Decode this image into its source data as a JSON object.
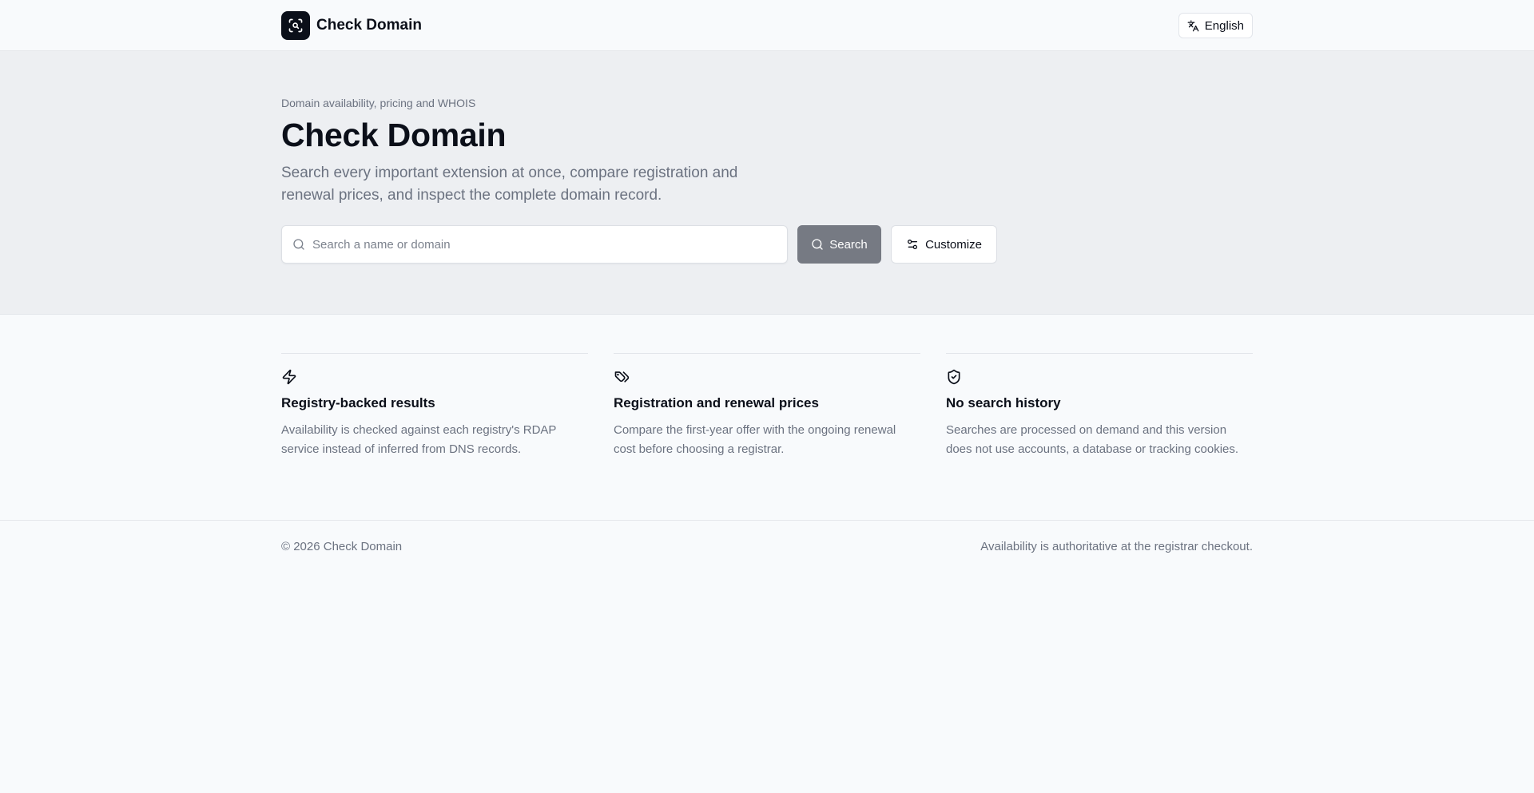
{
  "header": {
    "brand_name": "Check Domain",
    "language_label": "English"
  },
  "hero": {
    "eyebrow": "Domain availability, pricing and WHOIS",
    "title": "Check Domain",
    "description": "Search every important extension at once, compare registration and renewal prices, and inspect the complete domain record.",
    "search": {
      "placeholder": "Search a name or domain",
      "value": "",
      "button_label": "Search"
    },
    "customize_label": "Customize"
  },
  "features": [
    {
      "icon": "zap-icon",
      "title": "Registry-backed results",
      "description": "Availability is checked against each registry's RDAP service instead of inferred from DNS records."
    },
    {
      "icon": "tags-icon",
      "title": "Registration and renewal prices",
      "description": "Compare the first-year offer with the ongoing renewal cost before choosing a registrar."
    },
    {
      "icon": "shield-check-icon",
      "title": "No search history",
      "description": "Searches are processed on demand and this version does not use accounts, a database or tracking cookies."
    }
  ],
  "footer": {
    "copyright": "© 2026 Check Domain",
    "note": "Availability is authoritative at the registrar checkout."
  },
  "colors": {
    "primary": "#0b0f19",
    "muted_text": "#6b7280",
    "hero_bg": "#edeff2",
    "page_bg": "#f8fafc",
    "search_button_bg": "#767a83"
  }
}
